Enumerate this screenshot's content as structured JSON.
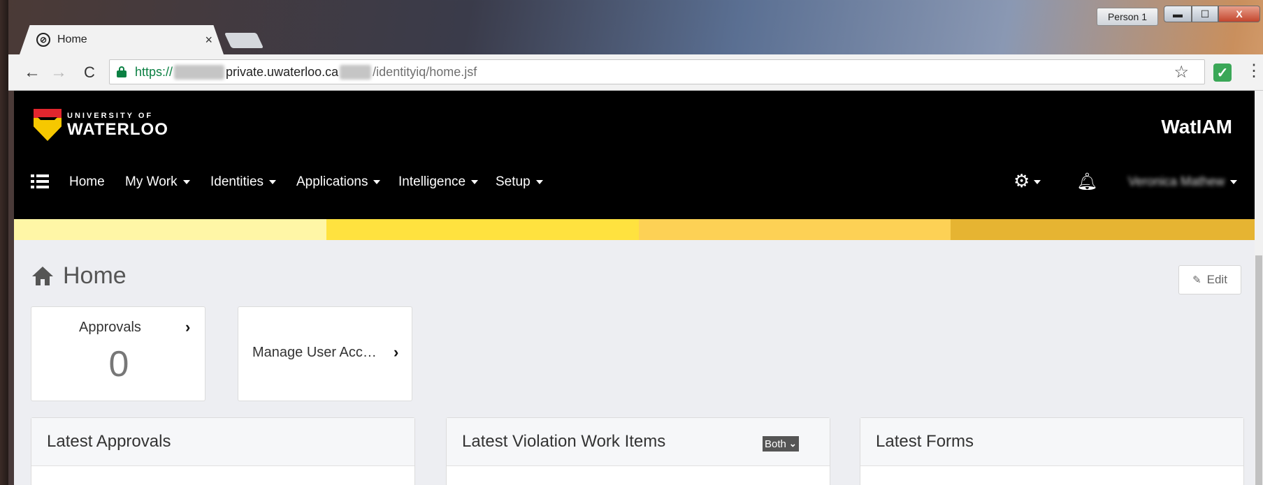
{
  "window": {
    "person_label": "Person 1",
    "min_label": "▬",
    "max_label": "☐",
    "close_label": "X"
  },
  "browser": {
    "tab_title": "Home",
    "tab_close": "×",
    "url": {
      "scheme": "https://",
      "host_mid": "private.uwaterloo.ca",
      "path": "/identityiq/home.jsf"
    }
  },
  "site": {
    "logo_small": "UNIVERSITY OF",
    "logo_big": "WATERLOO",
    "product_name": "WatIAM",
    "nav": [
      {
        "label": "Home"
      },
      {
        "label": "My Work"
      },
      {
        "label": "Identities"
      },
      {
        "label": "Applications"
      },
      {
        "label": "Intelligence"
      },
      {
        "label": "Setup"
      }
    ],
    "user_name": "Veronica Mathew"
  },
  "page": {
    "title": "Home",
    "edit_label": "Edit",
    "widgets": {
      "approvals": {
        "label": "Approvals",
        "count": "0"
      },
      "manage": {
        "label": "Manage User Acc…"
      }
    },
    "panels": {
      "approvals": {
        "title": "Latest Approvals"
      },
      "violations": {
        "title": "Latest Violation Work Items",
        "filter": "Both"
      },
      "forms": {
        "title": "Latest Forms"
      }
    }
  },
  "colors": {
    "stripe_1": "#fff6a6",
    "stripe_2": "#ffe23f",
    "stripe_3": "#fdd155",
    "stripe_4": "#e6b432",
    "header_bg": "#000000",
    "secure_green": "#0b8043"
  }
}
